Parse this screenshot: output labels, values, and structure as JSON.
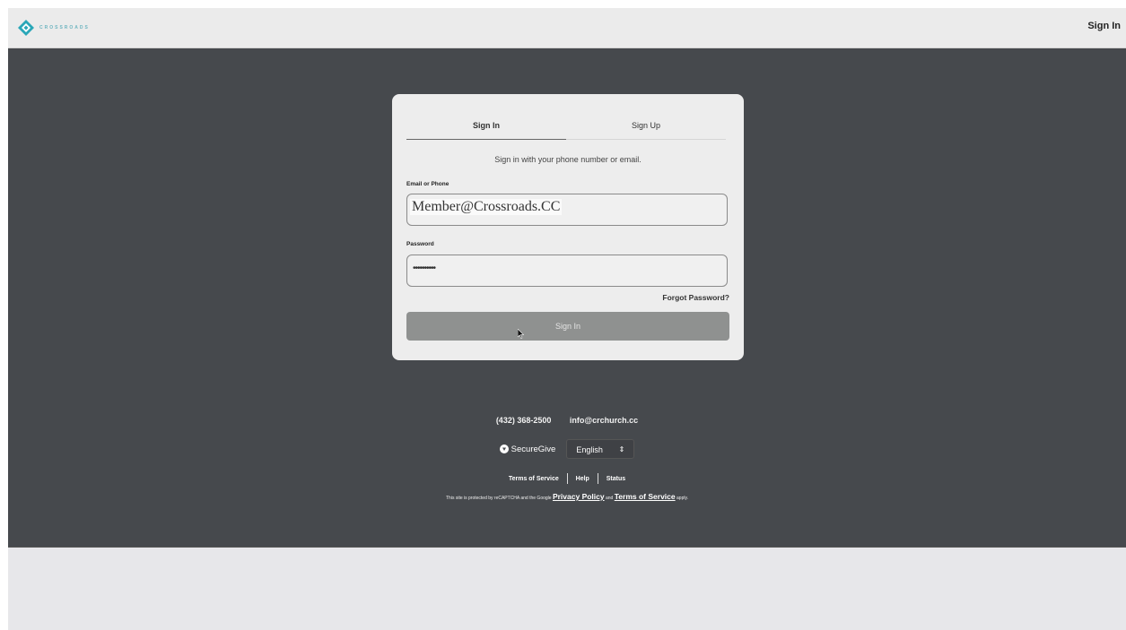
{
  "header": {
    "logo_text": "CROSSROADS",
    "sign_in_link": "Sign In"
  },
  "card": {
    "tabs": [
      {
        "label": "Sign In",
        "active": true
      },
      {
        "label": "Sign Up",
        "active": false
      }
    ],
    "subtitle": "Sign in with your phone number or email.",
    "email_label": "Email or Phone",
    "email_value": "Member@Crossroads.CC",
    "password_label": "Password",
    "password_value": "••••••••••",
    "forgot_link": "Forgot Password?",
    "submit_label": "Sign In"
  },
  "footer": {
    "phone": "(432) 368-2500",
    "email": "info@crchurch.cc",
    "brand": "SecureGive",
    "language": "English",
    "links": [
      "Terms of Service",
      "Help",
      "Status"
    ],
    "legal_prefix": "This site is protected by reCAPTCHA and the Google",
    "privacy_policy": "Privacy Policy",
    "legal_and": "and",
    "terms_of_service": "Terms of Service",
    "legal_suffix": "apply."
  },
  "colors": {
    "main_bg": "#46494d",
    "topbar_bg": "#ebebeb",
    "card_bg": "#ededed",
    "button_bg": "#8f9190",
    "logo_accent": "#2aa7b8"
  }
}
